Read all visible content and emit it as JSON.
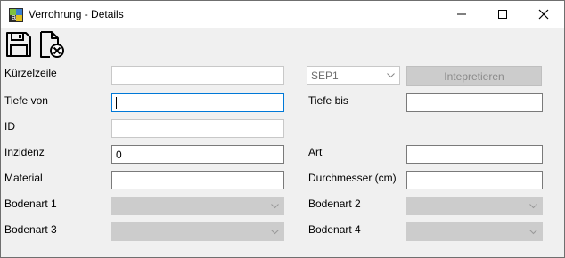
{
  "window": {
    "title": "Verrohrung - Details",
    "controls": [
      "minimize-icon",
      "maximize-icon",
      "close-icon"
    ]
  },
  "toolbar": {
    "buttons": [
      {
        "icon": "save-icon"
      },
      {
        "icon": "discard-icon"
      }
    ]
  },
  "form": {
    "kuerzelzeile": {
      "label": "Kürzelzeile",
      "value": ""
    },
    "sep_select": {
      "value": "SEP1"
    },
    "interpret_button": {
      "label": "Intepretieren"
    },
    "tiefe_von": {
      "label": "Tiefe von",
      "value": ""
    },
    "tiefe_bis": {
      "label": "Tiefe bis",
      "value": ""
    },
    "id": {
      "label": "ID",
      "value": ""
    },
    "inzidenz": {
      "label": "Inzidenz",
      "value": "0"
    },
    "art": {
      "label": "Art",
      "value": ""
    },
    "material": {
      "label": "Material",
      "value": ""
    },
    "durchmesser": {
      "label": "Durchmesser (cm)",
      "value": ""
    },
    "bodenart1": {
      "label": "Bodenart 1",
      "value": ""
    },
    "bodenart2": {
      "label": "Bodenart 2",
      "value": ""
    },
    "bodenart3": {
      "label": "Bodenart 3",
      "value": ""
    },
    "bodenart4": {
      "label": "Bodenart 4",
      "value": ""
    }
  },
  "colors": {
    "focus_border": "#0078d7",
    "disabled_bg": "#cccccc",
    "window_bg": "#f0f0f0"
  }
}
